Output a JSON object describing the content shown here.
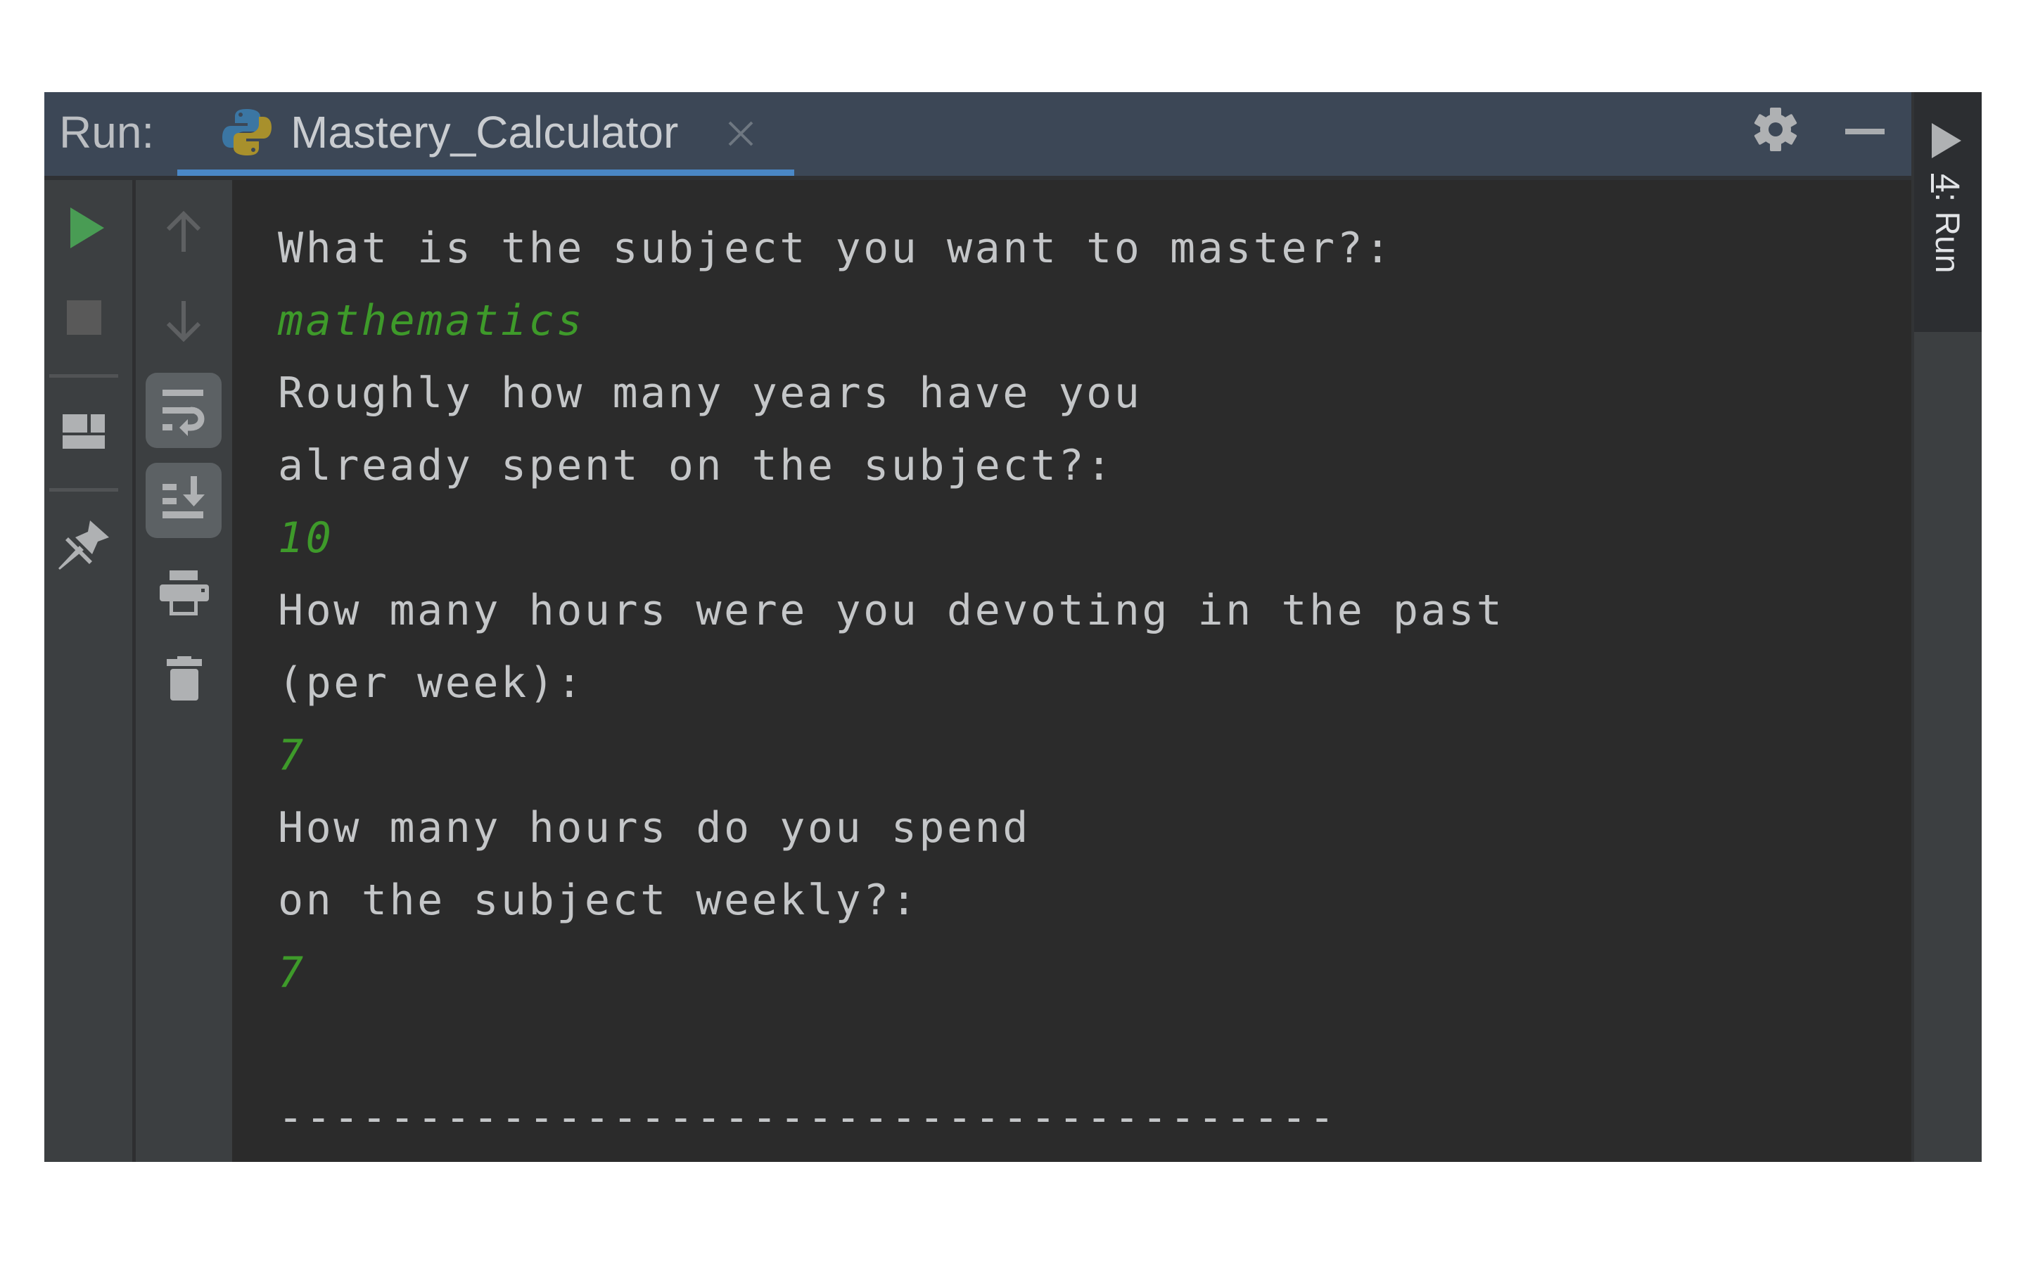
{
  "header": {
    "run_label": "Run:",
    "tab": {
      "title": "Mastery_Calculator",
      "icon": "python-icon",
      "close_icon": "close-icon",
      "active": true
    },
    "actions": [
      {
        "name": "settings",
        "icon": "gear-icon"
      },
      {
        "name": "hide",
        "icon": "minimize-icon"
      }
    ]
  },
  "right_strip": {
    "label_mnemonic": "4",
    "label_rest": ": Run",
    "icon": "run-triangle-icon"
  },
  "toolbar_left": [
    {
      "name": "rerun",
      "icon": "play-icon",
      "color": "#499c54"
    },
    {
      "name": "stop",
      "icon": "stop-icon",
      "enabled": false
    },
    {
      "name": "restore-layout",
      "icon": "layout-icon"
    },
    {
      "name": "pin-tab",
      "icon": "pin-icon"
    }
  ],
  "toolbar_right": [
    {
      "name": "previous-occurrence",
      "icon": "arrow-up-icon",
      "enabled": false
    },
    {
      "name": "next-occurrence",
      "icon": "arrow-down-icon",
      "enabled": false
    },
    {
      "name": "soft-wrap",
      "icon": "soft-wrap-icon",
      "toggled": true
    },
    {
      "name": "scroll-to-end",
      "icon": "scroll-to-end-icon",
      "toggled": true
    },
    {
      "name": "print",
      "icon": "print-icon"
    },
    {
      "name": "clear-all",
      "icon": "trash-icon"
    }
  ],
  "console": {
    "lines": [
      {
        "type": "output",
        "text": "What is the subject you want to master?:"
      },
      {
        "type": "input",
        "text": "mathematics"
      },
      {
        "type": "output",
        "text": "Roughly how many years have you"
      },
      {
        "type": "output",
        "text": "already spent on the subject?:"
      },
      {
        "type": "input",
        "text": "10"
      },
      {
        "type": "output",
        "text": "How many hours were you devoting in the past"
      },
      {
        "type": "output",
        "text": "(per week):"
      },
      {
        "type": "input",
        "text": "7"
      },
      {
        "type": "output",
        "text": "How many hours do you spend"
      },
      {
        "type": "output",
        "text": "on the subject weekly?:"
      },
      {
        "type": "input",
        "text": "7"
      },
      {
        "type": "output",
        "text": ""
      },
      {
        "type": "output",
        "text": "--------------------------------------"
      }
    ]
  },
  "colors": {
    "accent": "#4a88c7",
    "input_text": "#3e9a2a",
    "output_text": "#c4c6c8",
    "run_green": "#499c54",
    "header_bg": "#3c4756",
    "console_bg": "#2b2b2b"
  }
}
